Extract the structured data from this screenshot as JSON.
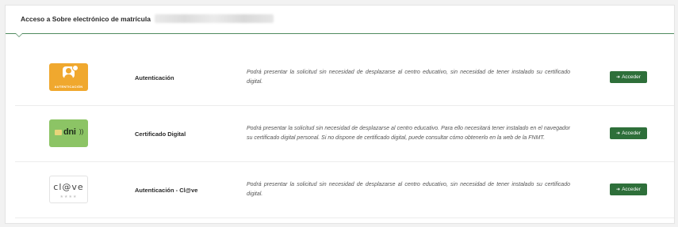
{
  "panel": {
    "title": "Acceso a Sobre electrónico de matrícula"
  },
  "rows": [
    {
      "logo_caption": "AUTENTICACIÓN",
      "method": "Autenticación",
      "description": "Podrá presentar la solicitud sin necesidad de desplazarse al centro educativo, sin necesidad de tener instalado su certificado digital.",
      "button": "Acceder"
    },
    {
      "logo_caption": "dni",
      "method": "Certificado Digital",
      "description": "Podrá presentar la solicitud sin necesidad de desplazarse al centro educativo. Para ello necesitará tener instalado en el navegador su certificado digital personal. Si no dispone de certificado digital, puede consultar cómo obtenerlo en la web de la FNMT.",
      "button": "Acceder"
    },
    {
      "logo_caption": "cl@ve",
      "method": "Autenticación - Cl@ve",
      "description": "Podrá presentar la solicitud sin necesidad de desplazarse al centro educativo, sin necesidad de tener instalado su certificado digital.",
      "button": "Acceder"
    }
  ],
  "icons": {
    "login": "sign-in-icon",
    "person": "user-badge-icon"
  },
  "colors": {
    "accent": "#4f8a5e",
    "button": "#2e6f3a",
    "auth_logo": "#f0a82e",
    "dni_logo": "#8cc465"
  }
}
